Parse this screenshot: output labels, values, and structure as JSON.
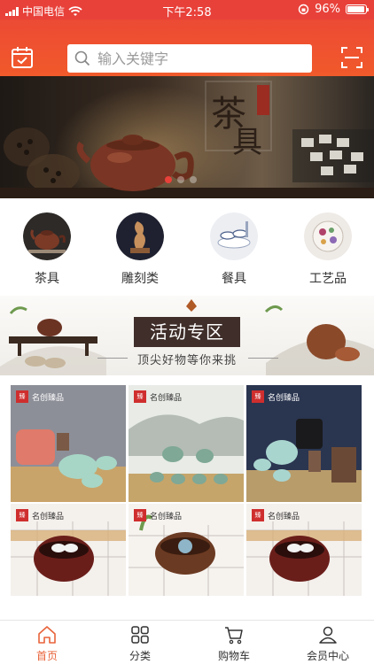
{
  "status_bar": {
    "carrier": "中国电信",
    "time": "下午2:58",
    "battery": "96%",
    "battery_level": 0.96
  },
  "header": {
    "calendar_icon": "calendar-check-icon",
    "search_placeholder": "输入关键字",
    "search_icon": "search-icon",
    "scan_icon": "scan-icon"
  },
  "banner": {
    "slides": 3,
    "active_slide": 0
  },
  "categories": [
    {
      "label": "茶具",
      "icon": "teapot"
    },
    {
      "label": "雕刻类",
      "icon": "carving"
    },
    {
      "label": "餐具",
      "icon": "tableware"
    },
    {
      "label": "工艺品",
      "icon": "crafts"
    }
  ],
  "promo": {
    "title": "活动专区",
    "subtitle": "顶尖好物等你来挑"
  },
  "products": {
    "brand": "名创臻品",
    "count": 6
  },
  "tabbar": {
    "items": [
      {
        "label": "首页",
        "icon": "home-icon",
        "active": true
      },
      {
        "label": "分类",
        "icon": "grid-icon",
        "active": false
      },
      {
        "label": "购物车",
        "icon": "cart-icon",
        "active": false
      },
      {
        "label": "会员中心",
        "icon": "user-icon",
        "active": false
      }
    ]
  },
  "colors": {
    "accent": "#e8413a",
    "tab_active": "#e8633a"
  }
}
